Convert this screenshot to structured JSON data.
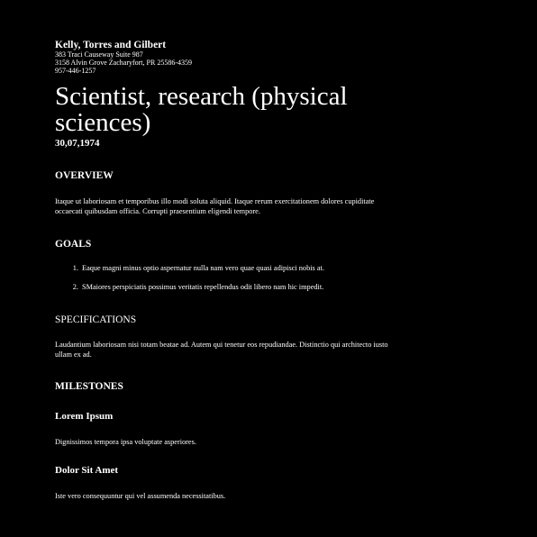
{
  "header": {
    "company": "Kelly, Torres and Gilbert",
    "address_line1": "383 Traci Causeway Suite 987",
    "address_line2": "3158 Alvin Grove Zacharyfort, PR 25586-4359",
    "phone": "957-446-1257"
  },
  "document": {
    "title": "Scientist, research (physical sciences)",
    "date": "30,07,1974"
  },
  "overview": {
    "heading": "OVERVIEW",
    "text": "Itaque ut laboriosam et temporibus illo modi soluta aliquid. Itaque rerum exercitationem dolores cupiditate occaecati quibusdam officia. Corrupti praesentium eligendi tempore."
  },
  "goals": {
    "heading": "GOALS",
    "items": [
      "Eaque magni minus optio aspernatur nulla nam vero quae quasi adipisci nobis at.",
      "SMaiores perspiciatis possimus veritatis repellendus odit libero nam hic impedit."
    ]
  },
  "specifications": {
    "heading": "SPECIFICATIONS",
    "text": "Laudantium laboriosam nisi totam beatae ad. Autem qui tenetur eos repudiandae. Distinctio qui architecto iusto ullam ex ad."
  },
  "milestones": {
    "heading": "MILESTONES",
    "items": [
      {
        "title": "Lorem Ipsum",
        "text": "Dignissimos tempora ipsa voluptate asperiores."
      },
      {
        "title": "Dolor Sit Amet",
        "text": "Iste vero consequuntur qui vel assumenda necessitatibus."
      }
    ]
  }
}
